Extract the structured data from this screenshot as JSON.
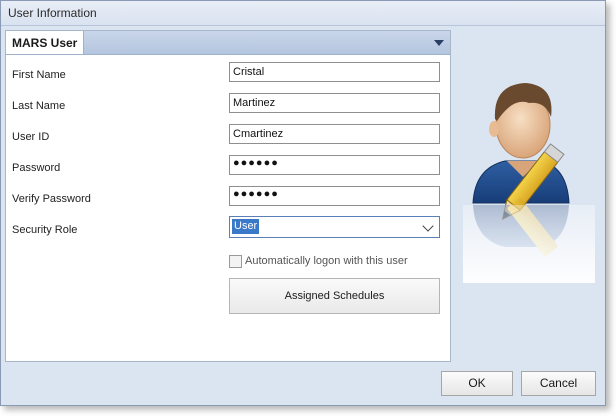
{
  "window": {
    "title": "User Information"
  },
  "tab": {
    "label": "MARS User"
  },
  "form": {
    "first_name": {
      "label": "First Name",
      "value": "Cristal"
    },
    "last_name": {
      "label": "Last Name",
      "value": "Martinez"
    },
    "user_id": {
      "label": "User ID",
      "value": "Cmartinez"
    },
    "password": {
      "label": "Password",
      "value": "●●●●●●"
    },
    "verify_password": {
      "label": "Verify Password",
      "value": "●●●●●●"
    },
    "security_role": {
      "label": "Security Role",
      "value": "User"
    },
    "auto_logon": {
      "label": "Automatically logon with this user",
      "checked": false
    },
    "assigned_schedules": {
      "label": "Assigned Schedules"
    }
  },
  "buttons": {
    "ok": "OK",
    "cancel": "Cancel"
  },
  "icons": {
    "avatar": "user-edit-icon",
    "tab_menu": "dropdown-arrow-icon"
  }
}
